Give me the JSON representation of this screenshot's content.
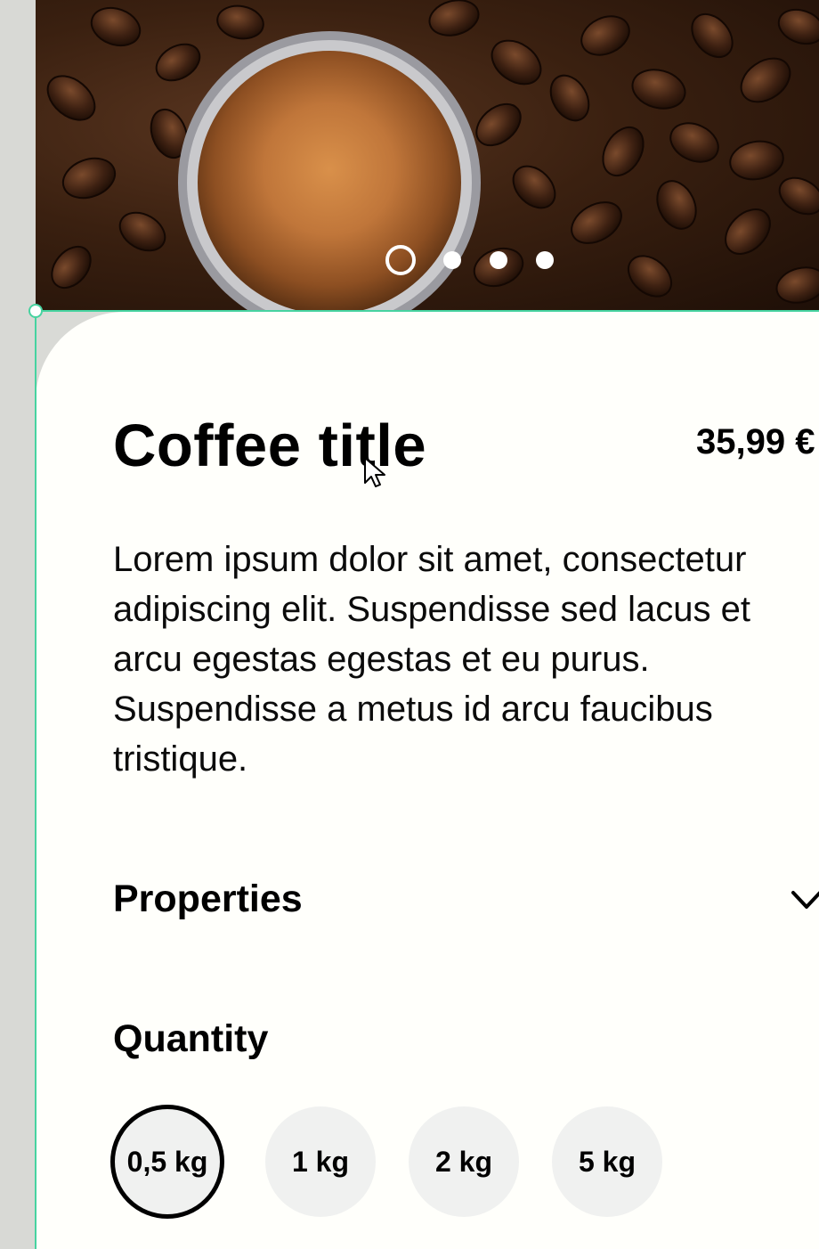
{
  "hero": {
    "image_description_icon": "coffee-cup-photo",
    "carousel": {
      "count": 4,
      "active_index": 0
    }
  },
  "product": {
    "title": "Coffee title",
    "price": "35,99 €",
    "description": "Lorem ipsum dolor sit amet, consectetur adipiscing elit. Suspendisse sed lacus et arcu egestas egestas et eu purus. Suspendisse a metus id arcu faucibus tristique."
  },
  "properties": {
    "label": "Properties",
    "icon": "chevron-down-icon"
  },
  "quantity": {
    "label": "Quantity",
    "options": [
      "0,5 kg",
      "1 kg",
      "2 kg",
      "5 kg"
    ],
    "selected_index": 0
  },
  "colors": {
    "selection_accent": "#47d3a0",
    "sheet_background": "#fffffb",
    "option_background": "#f0f1f0",
    "text": "#000000"
  }
}
